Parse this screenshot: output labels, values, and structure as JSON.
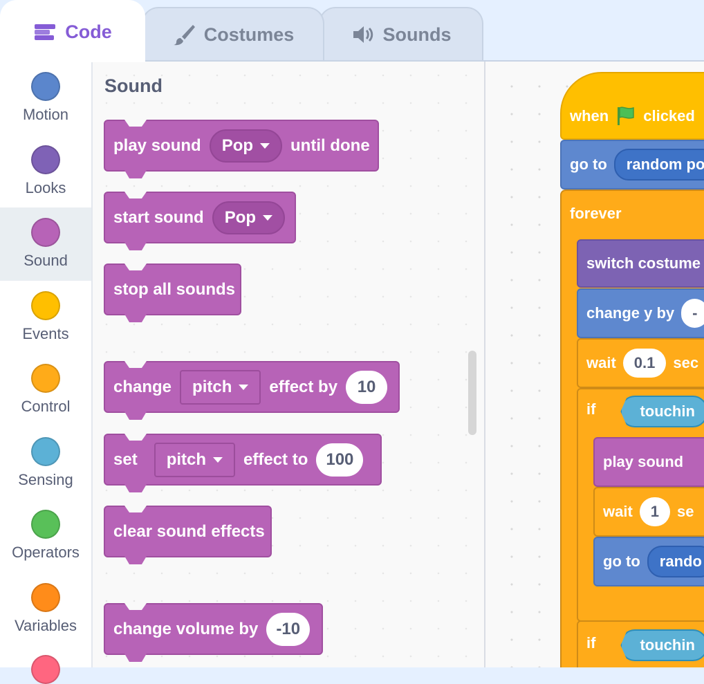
{
  "tabs": [
    {
      "label": "Code",
      "icon": "code-icon",
      "active": true
    },
    {
      "label": "Costumes",
      "icon": "paintbrush-icon",
      "active": false
    },
    {
      "label": "Sounds",
      "icon": "speaker-icon",
      "active": false
    }
  ],
  "categories": [
    {
      "label": "Motion",
      "color": "#4c97ff"
    },
    {
      "label": "Looks",
      "color": "#9966ff"
    },
    {
      "label": "Sound",
      "color": "#cf63cf",
      "selected": true
    },
    {
      "label": "Events",
      "color": "#ffbf00"
    },
    {
      "label": "Control",
      "color": "#ffab19"
    },
    {
      "label": "Sensing",
      "color": "#5cb1d6"
    },
    {
      "label": "Operators",
      "color": "#59c059"
    },
    {
      "label": "Variables",
      "color": "#ff8c1a"
    }
  ],
  "palette": {
    "title": "Sound",
    "blocks": {
      "play_until_done": {
        "prefix": "play sound",
        "dropdown": "Pop",
        "suffix": "until done"
      },
      "start_sound": {
        "prefix": "start sound",
        "dropdown": "Pop"
      },
      "stop_all": {
        "label": "stop all sounds"
      },
      "change_effect": {
        "prefix": "change",
        "dropdown": "pitch",
        "middle": "effect by",
        "value": "10"
      },
      "set_effect": {
        "prefix": "set",
        "dropdown": "pitch",
        "middle": "effect to",
        "value": "100"
      },
      "clear_effects": {
        "label": "clear sound effects"
      },
      "change_volume": {
        "prefix": "change volume by",
        "value": "-10"
      }
    }
  },
  "script": {
    "hat": {
      "prefix": "when",
      "suffix": "clicked"
    },
    "goto1": {
      "prefix": "go to",
      "value": "random po"
    },
    "forever": {
      "label": "forever"
    },
    "switch_costume": {
      "label": "switch costume"
    },
    "change_y": {
      "prefix": "change y by",
      "value": "-"
    },
    "wait1": {
      "prefix": "wait",
      "value": "0.1",
      "suffix": "sec"
    },
    "if1": {
      "prefix": "if",
      "cond": "touchin"
    },
    "play_sound": {
      "label": "play sound"
    },
    "wait2": {
      "prefix": "wait",
      "value": "1",
      "suffix": "se"
    },
    "goto2": {
      "prefix": "go to",
      "value": "rando"
    },
    "if2": {
      "prefix": "if",
      "cond": "touchin"
    }
  }
}
